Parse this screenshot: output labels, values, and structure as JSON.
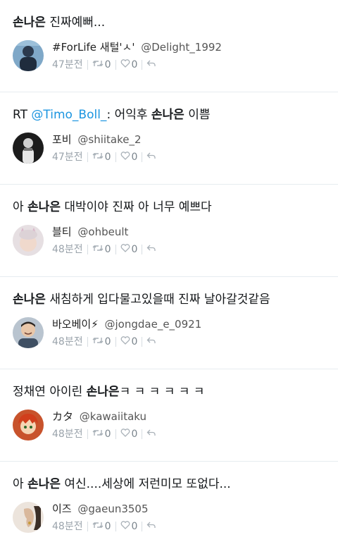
{
  "tweets": [
    {
      "parts": [
        {
          "text": "손나은",
          "kw": true
        },
        {
          "text": " 진짜예뻐..."
        }
      ],
      "name": "#ForLife 새털'ㅅ'",
      "handle": "@Delight_1992",
      "time": "47분전",
      "retweets": "0",
      "likes": "0",
      "avatar": "navy-figure"
    },
    {
      "parts": [
        {
          "text": "RT "
        },
        {
          "text": "@Timo_Boll_",
          "mention": true
        },
        {
          "text": ": 어익후 "
        },
        {
          "text": "손나은",
          "kw": true
        },
        {
          "text": " 이쁨"
        }
      ],
      "name": "포비",
      "handle": "@shiitake_2",
      "time": "47분전",
      "retweets": "0",
      "likes": "0",
      "avatar": "dark-portrait"
    },
    {
      "parts": [
        {
          "text": "아 "
        },
        {
          "text": "손나은",
          "kw": true
        },
        {
          "text": " 대박이야 진짜 아 너무 예쁘다"
        }
      ],
      "name": "블티",
      "handle": "@ohbeult",
      "time": "48분전",
      "retweets": "0",
      "likes": "0",
      "avatar": "cat-ears"
    },
    {
      "parts": [
        {
          "text": "손나은",
          "kw": true
        },
        {
          "text": " 새침하게 입다물고있을때 진짜 날아갈것같음"
        }
      ],
      "name": "바오베이⚡",
      "handle": "@jongdae_e_0921",
      "time": "48분전",
      "retweets": "0",
      "likes": "0",
      "avatar": "smiling-man"
    },
    {
      "parts": [
        {
          "text": "정채연 아이린 "
        },
        {
          "text": "손나은",
          "kw": true
        },
        {
          "text": "ㅋ ㅋ ㅋ ㅋ ㅋ ㅋ"
        }
      ],
      "name": "カタ",
      "handle": "@kawaiitaku",
      "time": "48분전",
      "retweets": "0",
      "likes": "0",
      "avatar": "anime-redhair"
    },
    {
      "parts": [
        {
          "text": "아 "
        },
        {
          "text": "손나은",
          "kw": true
        },
        {
          "text": " 여신....세상에 저런미모 또없다..."
        }
      ],
      "name": "이즈",
      "handle": "@gaeun3505",
      "time": "48분전",
      "retweets": "0",
      "likes": "0",
      "avatar": "ear-profile"
    }
  ],
  "icons": {
    "retweet": "retweet-icon",
    "like": "heart-icon",
    "reply": "reply-icon"
  }
}
